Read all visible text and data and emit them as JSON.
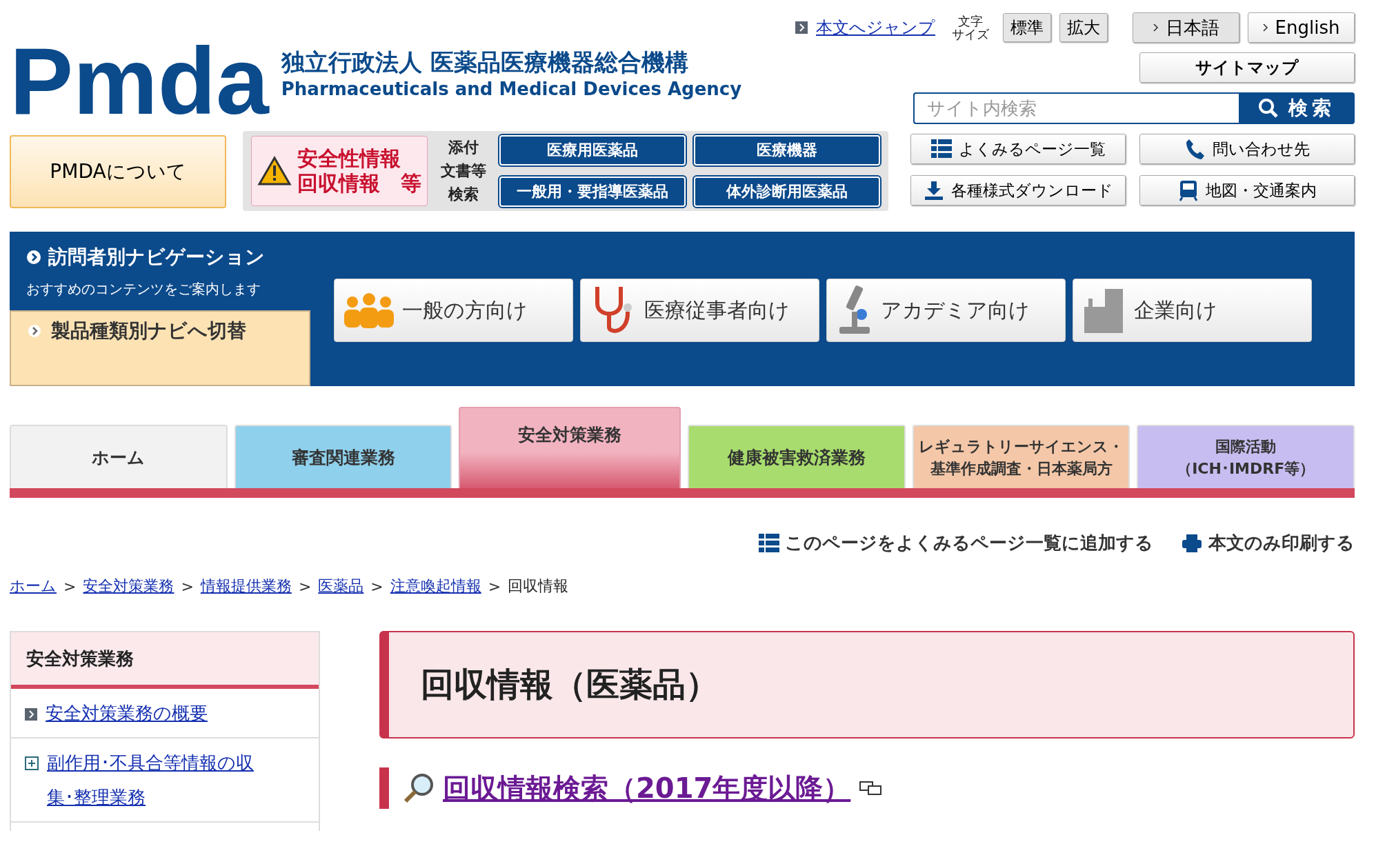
{
  "header": {
    "logo_text": "Pmda",
    "name_ja": "独立行政法人 医薬品医療機器総合機構",
    "name_en": "Pharmaceuticals and Medical Devices Agency",
    "skip_link": "本文へジャンプ",
    "font_size_label": [
      "文字",
      "サイズ"
    ],
    "font_sizes": [
      "標準",
      "拡大"
    ],
    "languages": [
      {
        "label": "日本語",
        "selected": true
      },
      {
        "label": "English",
        "selected": false
      }
    ],
    "sitemap": "サイトマップ",
    "search": {
      "placeholder": "サイト内検索",
      "button": "検索"
    }
  },
  "about_button": "PMDAについて",
  "safety_box": {
    "lines": [
      "安全性情報",
      "回収情報　等"
    ]
  },
  "document_search_label": [
    "添付",
    "文書等",
    "検索"
  ],
  "document_buttons": [
    "医療用医薬品",
    "医療機器",
    "一般用・要指導医薬品",
    "体外診断用医薬品"
  ],
  "quick_links": [
    "よくみるページ一覧",
    "問い合わせ先",
    "各種様式ダウンロード",
    "地図・交通案内"
  ],
  "visitor_nav": {
    "title": "訪問者別ナビゲーション",
    "subtitle": "おすすめのコンテンツをご案内します",
    "switch_link": "製品種類別ナビへ切替",
    "audiences": [
      "一般の方向け",
      "医療従事者向け",
      "アカデミア向け",
      "企業向け"
    ]
  },
  "tabs": [
    {
      "lines": [
        "ホーム"
      ],
      "selected": false,
      "color": "#f2f2f2"
    },
    {
      "lines": [
        "審査関連業務"
      ],
      "selected": false,
      "color": "#8fd0ec"
    },
    {
      "lines": [
        "安全対策業務"
      ],
      "selected": true,
      "color": "#f2b3c0"
    },
    {
      "lines": [
        "健康被害救済業務"
      ],
      "selected": false,
      "color": "#a8dc6e"
    },
    {
      "lines": [
        "レギュラトリーサイエンス・",
        "基準作成調査・日本薬局方"
      ],
      "selected": false,
      "color": "#f3c7a8"
    },
    {
      "lines": [
        "国際活動",
        "（ICH･IMDRF等）"
      ],
      "selected": false,
      "color": "#c7bdf0"
    }
  ],
  "page_tools": [
    "このページをよくみるページ一覧に追加する",
    "本文のみ印刷する"
  ],
  "breadcrumb": [
    {
      "label": "ホーム",
      "kind": "link"
    },
    {
      "label": ">",
      "kind": "separator"
    },
    {
      "label": "安全対策業務",
      "kind": "link"
    },
    {
      "label": ">",
      "kind": "separator"
    },
    {
      "label": "情報提供業務",
      "kind": "link"
    },
    {
      "label": ">",
      "kind": "separator"
    },
    {
      "label": "医薬品",
      "kind": "link"
    },
    {
      "label": ">",
      "kind": "separator"
    },
    {
      "label": "注意喚起情報",
      "kind": "link"
    },
    {
      "label": ">",
      "kind": "separator"
    },
    {
      "label": "回収情報",
      "kind": "current"
    }
  ],
  "sidebar": {
    "title": "安全対策業務",
    "items": [
      {
        "label": "安全対策業務の概要",
        "kind": "link"
      },
      {
        "label": "副作用･不具合等情報の収集･整理業務",
        "kind": "expandable"
      }
    ]
  },
  "page_title": "回収情報（医薬品）",
  "section_link": "回収情報検索（2017年度以降）"
}
